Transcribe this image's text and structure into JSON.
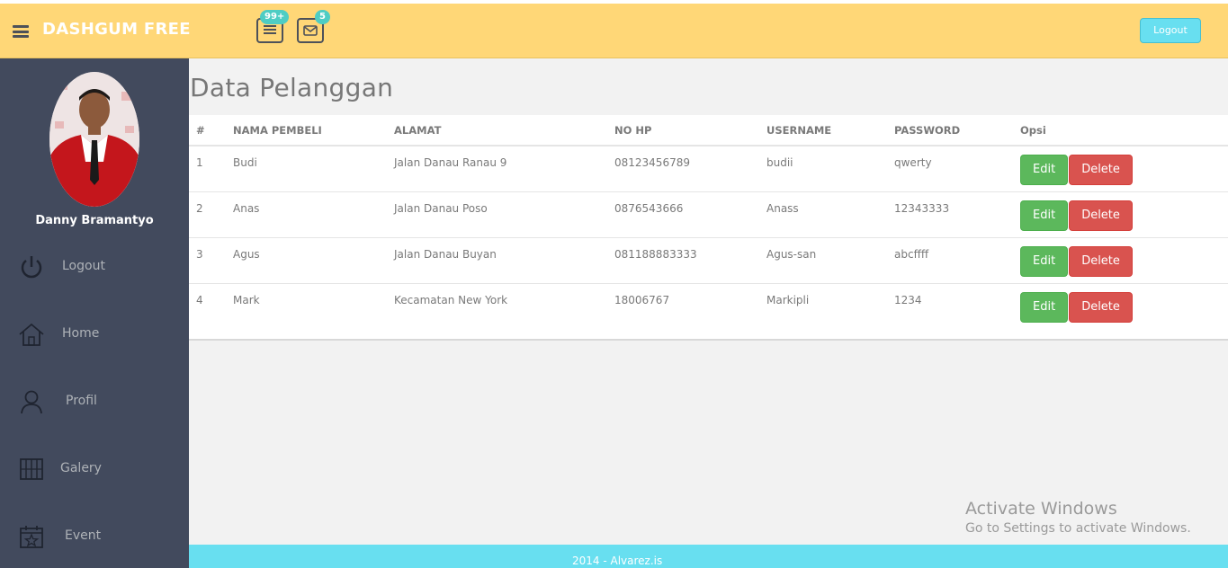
{
  "header": {
    "logo": "DASHGUM FREE",
    "tasks_badge": "99+",
    "mail_badge": "5",
    "logout_label": "Logout"
  },
  "sidebar": {
    "username": "Danny Bramantyo",
    "items": [
      {
        "label": "Logout",
        "icon": "power-icon"
      },
      {
        "label": "Home",
        "icon": "home-icon"
      },
      {
        "label": "Profil",
        "icon": "user-icon"
      },
      {
        "label": "Galery",
        "icon": "gallery-icon"
      },
      {
        "label": "Event",
        "icon": "calendar-icon"
      }
    ]
  },
  "main": {
    "title": "Data Pelanggan",
    "columns": [
      "#",
      "NAMA PEMBELI",
      "ALAMAT",
      "NO HP",
      "USERNAME",
      "PASSWORD",
      "Opsi"
    ],
    "rows": [
      {
        "no": "1",
        "nama": "Budi",
        "alamat": "Jalan Danau Ranau 9",
        "hp": "08123456789",
        "username": "budii",
        "password": "qwerty"
      },
      {
        "no": "2",
        "nama": "Anas",
        "alamat": "Jalan Danau Poso",
        "hp": "0876543666",
        "username": "Anass",
        "password": "12343333"
      },
      {
        "no": "3",
        "nama": "Agus",
        "alamat": "Jalan Danau Buyan",
        "hp": "081188883333",
        "username": "Agus-san",
        "password": "abcffff"
      },
      {
        "no": "4",
        "nama": "Mark",
        "alamat": "Kecamatan New York",
        "hp": "18006767",
        "username": "Markipli",
        "password": "1234"
      }
    ],
    "edit_label": "Edit",
    "delete_label": "Delete"
  },
  "footer": {
    "text": "2014 - Alvarez.is"
  },
  "watermark": {
    "title": "Activate Windows",
    "subtitle": "Go to Settings to activate Windows."
  },
  "colors": {
    "header": "#ffd777",
    "sidebar": "#424a5d",
    "accent": "#68dff0",
    "edit": "#5cb85c",
    "delete": "#d9534f"
  }
}
